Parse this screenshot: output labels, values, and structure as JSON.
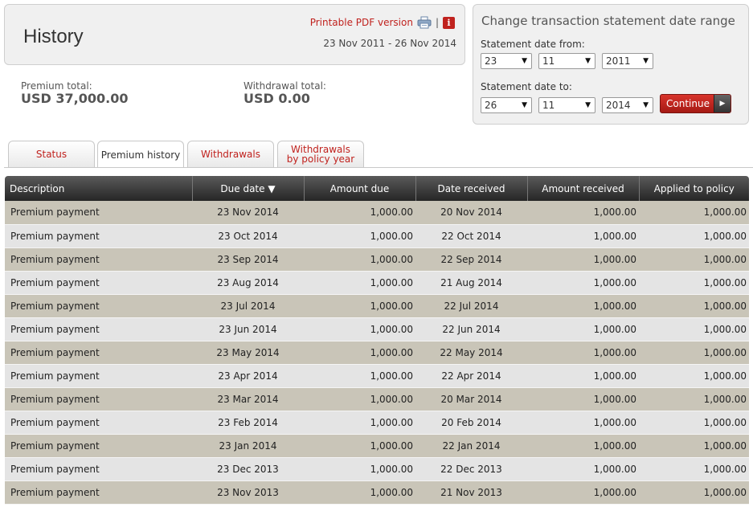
{
  "header": {
    "title": "History",
    "pdf_link": "Printable PDF version",
    "separator": "|",
    "info_glyph": "i",
    "date_range": "23 Nov 2011 - 26 Nov 2014",
    "icons": {
      "printer": "printer-icon",
      "info": "info-icon"
    }
  },
  "totals": {
    "premium_label": "Premium total:",
    "premium_value": "USD 37,000.00",
    "withdrawal_label": "Withdrawal total:",
    "withdrawal_value": "USD 0.00"
  },
  "range": {
    "title": "Change transaction statement date range",
    "from_label": "Statement date from:",
    "to_label": "Statement date to:",
    "from_day": "23",
    "from_month": "11",
    "from_year": "2011",
    "to_day": "26",
    "to_month": "11",
    "to_year": "2014",
    "continue_label": "Continue"
  },
  "tabs": [
    "Status",
    "Premium history",
    "Withdrawals",
    "Withdrawals by policy year"
  ],
  "active_tab": "Premium history",
  "colors": {
    "accent": "#c0221e",
    "row_odd": "#c9c5b8",
    "row_even": "#e4e4e4",
    "header_bg": "#3a3a3a"
  },
  "table": {
    "columns": [
      "Description",
      "Due date ▼",
      "Amount due",
      "Date received",
      "Amount received",
      "Applied to policy"
    ],
    "rows": [
      [
        "Premium payment",
        "23 Nov 2014",
        "1,000.00",
        "20 Nov 2014",
        "1,000.00",
        "1,000.00"
      ],
      [
        "Premium payment",
        "23 Oct 2014",
        "1,000.00",
        "22 Oct 2014",
        "1,000.00",
        "1,000.00"
      ],
      [
        "Premium payment",
        "23 Sep 2014",
        "1,000.00",
        "22 Sep 2014",
        "1,000.00",
        "1,000.00"
      ],
      [
        "Premium payment",
        "23 Aug 2014",
        "1,000.00",
        "21 Aug 2014",
        "1,000.00",
        "1,000.00"
      ],
      [
        "Premium payment",
        "23 Jul 2014",
        "1,000.00",
        "22 Jul 2014",
        "1,000.00",
        "1,000.00"
      ],
      [
        "Premium payment",
        "23 Jun 2014",
        "1,000.00",
        "22 Jun 2014",
        "1,000.00",
        "1,000.00"
      ],
      [
        "Premium payment",
        "23 May 2014",
        "1,000.00",
        "22 May 2014",
        "1,000.00",
        "1,000.00"
      ],
      [
        "Premium payment",
        "23 Apr 2014",
        "1,000.00",
        "22 Apr 2014",
        "1,000.00",
        "1,000.00"
      ],
      [
        "Premium payment",
        "23 Mar 2014",
        "1,000.00",
        "20 Mar 2014",
        "1,000.00",
        "1,000.00"
      ],
      [
        "Premium payment",
        "23 Feb 2014",
        "1,000.00",
        "20 Feb 2014",
        "1,000.00",
        "1,000.00"
      ],
      [
        "Premium payment",
        "23 Jan 2014",
        "1,000.00",
        "22 Jan 2014",
        "1,000.00",
        "1,000.00"
      ],
      [
        "Premium payment",
        "23 Dec 2013",
        "1,000.00",
        "22 Dec 2013",
        "1,000.00",
        "1,000.00"
      ],
      [
        "Premium payment",
        "23 Nov 2013",
        "1,000.00",
        "21 Nov 2013",
        "1,000.00",
        "1,000.00"
      ]
    ]
  }
}
